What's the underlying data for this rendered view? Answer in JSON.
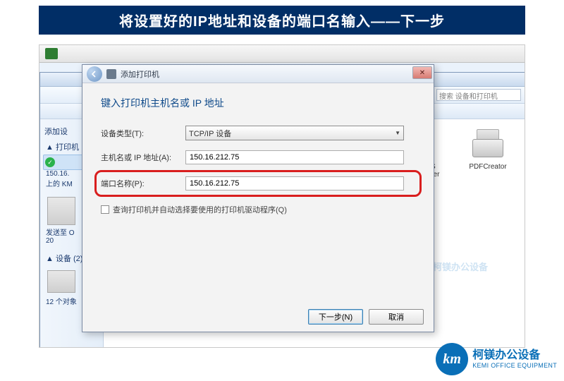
{
  "slide": {
    "title": "将设置好的IP地址和设备的端口名输入——下一步"
  },
  "explorer": {
    "search_placeholder": "搜索 设备和打印机",
    "side": {
      "add": "添加设",
      "printers_header": "打印机",
      "selected_label": "150.16.\n上的 KM",
      "scanner_label": "发送至 O\n20",
      "devices_header": "设备 (2)",
      "bottom_label": "12 个对象"
    },
    "printers": [
      {
        "name": "Microsoft XPS Document Writer"
      },
      {
        "name": "PDFCreator"
      }
    ]
  },
  "dialog": {
    "title": "添加打印机",
    "heading": "键入打印机主机名或 IP 地址",
    "fields": {
      "device_type_label": "设备类型(T):",
      "device_type_value": "TCP/IP 设备",
      "host_label": "主机名或 IP 地址(A):",
      "host_value": "150.16.212.75",
      "port_label": "端口名称(P):",
      "port_value": "150.16.212.75",
      "autodetect_label": "查询打印机并自动选择要使用的打印机驱动程序(Q)"
    },
    "buttons": {
      "next": "下一步(N)",
      "cancel": "取消"
    }
  },
  "brand": {
    "logo_text": "km",
    "name": "柯镁办公设备",
    "sub": "KEMI OFFICE EQUIPMENT"
  },
  "watermark": {
    "text": "柯镁办公设备"
  }
}
